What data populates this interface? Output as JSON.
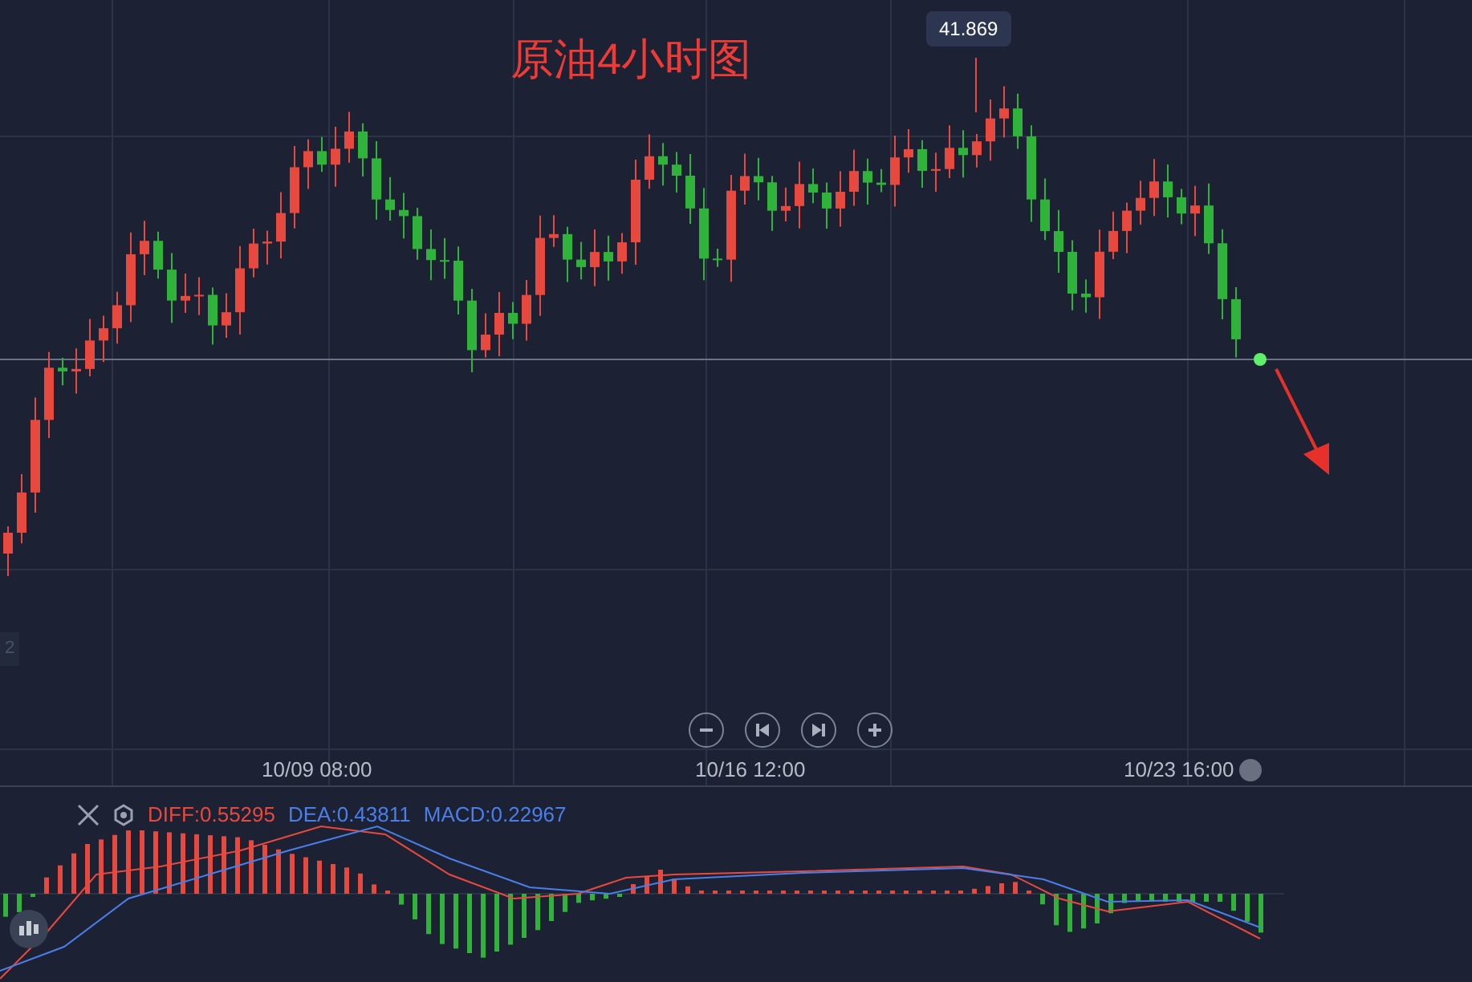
{
  "chart_title": "原油4小时图",
  "price_tooltip": "41.869",
  "left_price_marker": "2",
  "x_axis": {
    "labels": [
      "10/09 08:00",
      "10/16 12:00",
      "10/23 16:00"
    ]
  },
  "macd_legend": [
    {
      "text": "DIFF:0.55295",
      "color": "#e8493f"
    },
    {
      "text": "DEA:0.43811",
      "color": "#4a7ee8"
    },
    {
      "text": "MACD:0.22967",
      "color": "#4a7ee8"
    }
  ]
}
